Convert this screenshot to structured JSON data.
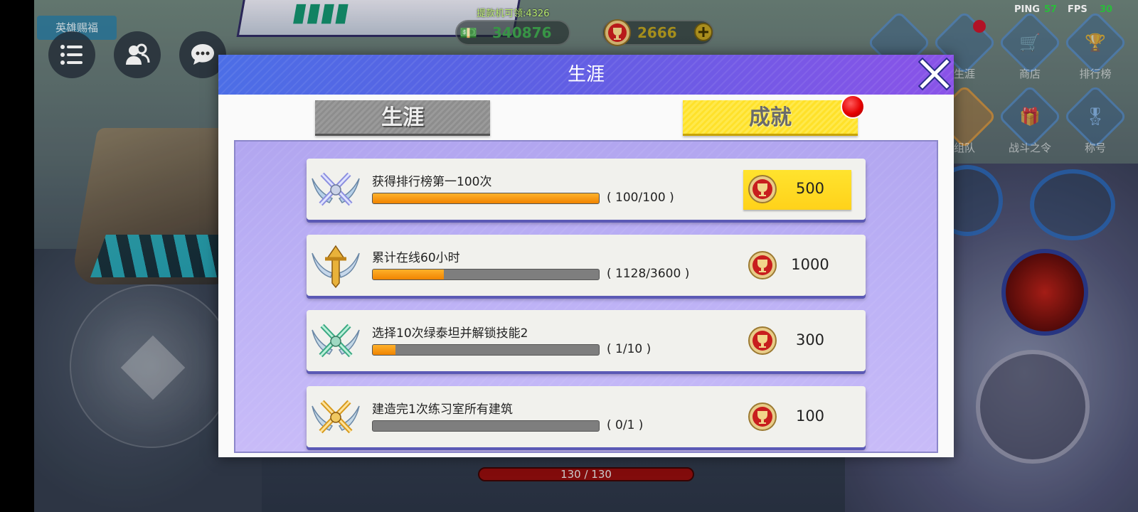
{
  "hud": {
    "event_tag": "英雄赐福",
    "cash_message": "提款机可领:4326",
    "cash_amount": "340876",
    "trophy_amount": "2666",
    "ping_label": "PING",
    "ping_value": "57",
    "fps_label": "FPS",
    "fps_value": "30",
    "side_menu": [
      {
        "label": "生涯",
        "icon": "career-icon"
      },
      {
        "label": "商店",
        "icon": "shop-icon"
      },
      {
        "label": "排行榜",
        "icon": "leaderboard-icon"
      },
      {
        "label": "组队",
        "icon": "team-icon"
      },
      {
        "label": "战斗之令",
        "icon": "battle-pass-icon"
      },
      {
        "label": "称号",
        "icon": "title-icon"
      }
    ],
    "hp_text": "130 / 130"
  },
  "dialog": {
    "title": "生涯",
    "tabs": [
      {
        "label": "生涯",
        "active": false
      },
      {
        "label": "成就",
        "active": true
      }
    ],
    "achievements": [
      {
        "title": "获得排行榜第一100次",
        "progress_text": "( 100/100 )",
        "progress": 1.0,
        "reward": "500",
        "claimable": true,
        "emblem": "silver-crossed-swords-emblem"
      },
      {
        "title": "累计在线60小时",
        "progress_text": "( 1128/3600 )",
        "progress": 0.313,
        "reward": "1000",
        "claimable": false,
        "emblem": "gold-winged-emblem"
      },
      {
        "title": "选择10次绿泰坦并解锁技能2",
        "progress_text": "( 1/10 )",
        "progress": 0.1,
        "reward": "300",
        "claimable": false,
        "emblem": "green-crossed-swords-emblem"
      },
      {
        "title": "建造完1次练习室所有建筑",
        "progress_text": "( 0/1 )",
        "progress": 0.0,
        "reward": "100",
        "claimable": false,
        "emblem": "gold-crossed-swords-emblem"
      }
    ]
  },
  "colors": {
    "header_start": "#4c6ee6",
    "header_end": "#8a53e8",
    "tab_active": "#ffe12a",
    "progress_fill": "#f08400",
    "reward_highlight": "#ffe32e"
  }
}
